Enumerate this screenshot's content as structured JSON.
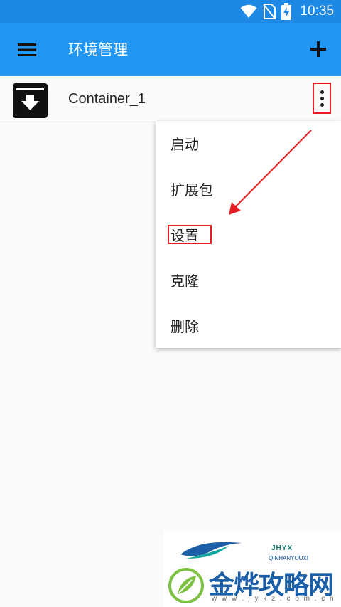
{
  "status_bar": {
    "time": "10:35",
    "icons": [
      "wifi-icon",
      "no-sim-icon",
      "battery-charging-icon"
    ]
  },
  "app_bar": {
    "title": "环境管理",
    "menu_icon": "hamburger-menu-icon",
    "add_icon": "plus-icon"
  },
  "list": {
    "items": [
      {
        "label": "Container_1",
        "icon": "archive-box-icon"
      }
    ]
  },
  "popup_menu": {
    "items": [
      {
        "label": "启动"
      },
      {
        "label": "扩展包"
      },
      {
        "label": "设置"
      },
      {
        "label": "克隆"
      },
      {
        "label": "删除"
      }
    ]
  },
  "watermark": {
    "brand": "JHYX",
    "sub": "QINHANYOUXI",
    "title": "金烨攻略网",
    "url": "w w w . j y k z . c o m . c n"
  },
  "colors": {
    "status_bar": "#1e88e5",
    "app_bar": "#2196f3",
    "annotation_red": "#e51c23"
  }
}
